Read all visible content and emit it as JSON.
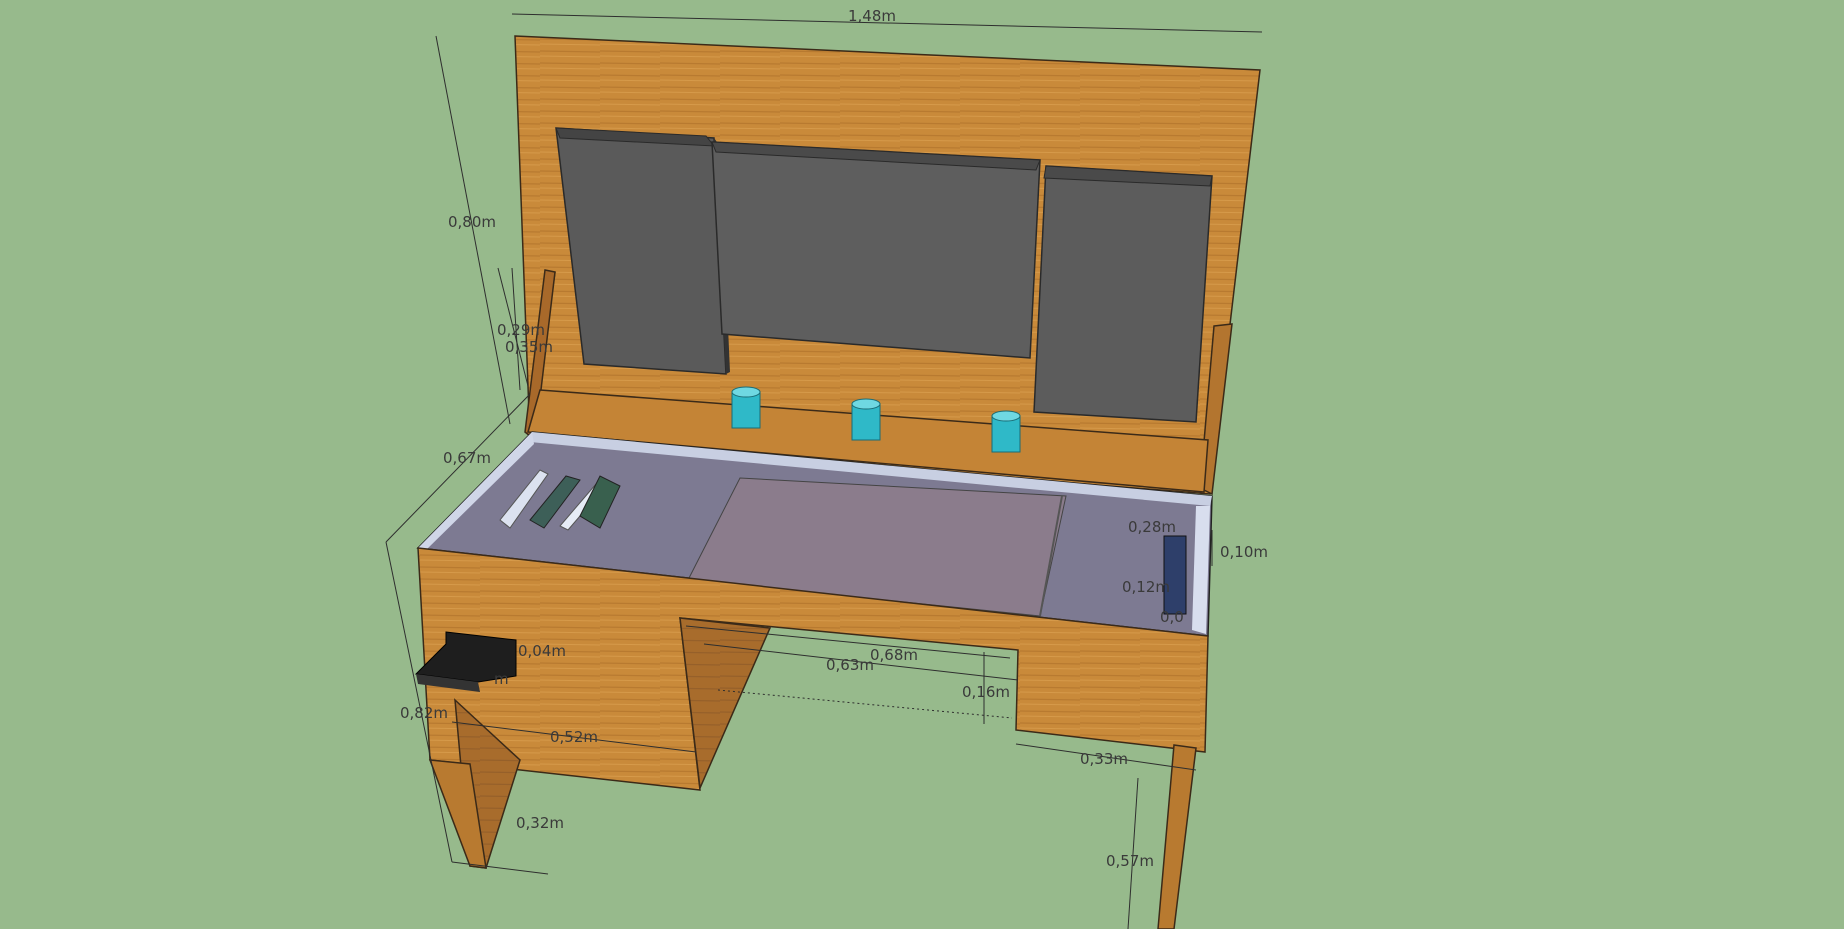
{
  "colors": {
    "background": "#97ba8c",
    "wood": "#c98a3a",
    "wood_dark": "#8a5522",
    "panel": "#5c5c5c",
    "glass": "#9aa3b8",
    "cup": "#2fb9c8",
    "tray": "#1e1e1e"
  },
  "dimensions": {
    "width_top": "1,48m",
    "height_back": "0,80m",
    "side_upper": "0,29m",
    "side_mid": "0,35m",
    "depth": "0,67m",
    "leg_height": "0,82m",
    "tray_h": "0,04m",
    "tray_w": "m",
    "inner_width": "0,52m",
    "foot": "0,32m",
    "recess_outer": "0,68m",
    "recess_inner": "0,63m",
    "recess_depth": "0,16m",
    "right_leg": "0,33m",
    "knee_height": "0,57m",
    "box_height": "0,10m",
    "inner_a": "0,28m",
    "inner_b": "0,12m",
    "inner_c": "0,0"
  }
}
